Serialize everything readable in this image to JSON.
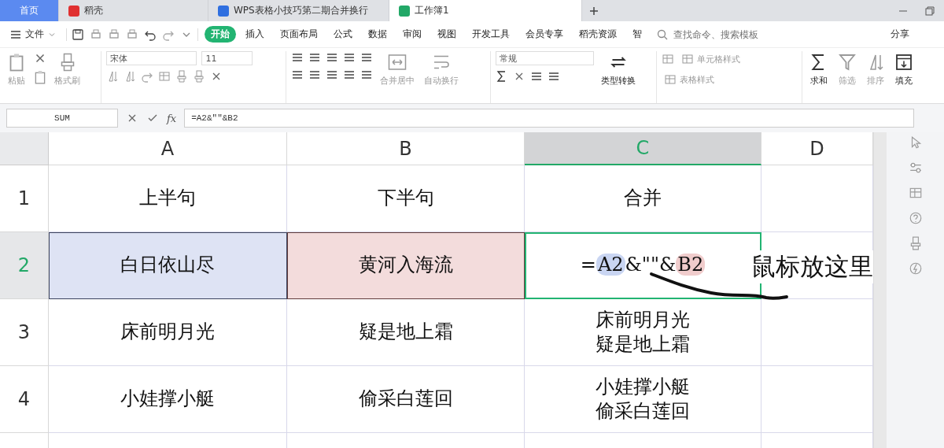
{
  "tabs": [
    {
      "label": "首页",
      "kind": "home",
      "selected": false
    },
    {
      "label": "稻壳",
      "kind": "app",
      "selected": false
    },
    {
      "label": "WPS表格小技巧第二期合并换行",
      "kind": "doc",
      "selected": false
    },
    {
      "label": "工作簿1",
      "kind": "sheet",
      "selected": true
    }
  ],
  "menu": {
    "file": "文件",
    "ribbon_tabs": [
      {
        "label": "开始",
        "selected": true
      },
      {
        "label": "插入",
        "selected": false
      },
      {
        "label": "页面布局",
        "selected": false
      },
      {
        "label": "公式",
        "selected": false
      },
      {
        "label": "数据",
        "selected": false
      },
      {
        "label": "审阅",
        "selected": false
      },
      {
        "label": "视图",
        "selected": false
      },
      {
        "label": "开发工具",
        "selected": false
      },
      {
        "label": "会员专享",
        "selected": false
      },
      {
        "label": "稻壳资源",
        "selected": false
      },
      {
        "label": "智",
        "selected": false
      }
    ],
    "search": {
      "placeholder": "查找命令、搜索模板"
    },
    "share": "分享"
  },
  "ribbon": {
    "font": "宋体",
    "size": "11",
    "number_format": "常规",
    "buttons": [
      {
        "label": "粘贴",
        "disabled": true
      },
      {
        "label": "格式刷",
        "disabled": true
      },
      {
        "label": "合并居中",
        "disabled": true
      },
      {
        "label": "自动换行",
        "disabled": true
      },
      {
        "label": "类型转换",
        "disabled": false
      },
      {
        "label": "单元格样式",
        "disabled": true
      },
      {
        "label": "表格样式",
        "disabled": true
      },
      {
        "label": "求和",
        "disabled": false
      },
      {
        "label": "筛选",
        "disabled": true
      },
      {
        "label": "排序",
        "disabled": true
      },
      {
        "label": "填充",
        "disabled": false
      }
    ]
  },
  "formula_bar": {
    "name_box": "SUM",
    "fx": "fx",
    "formula": "=A2&\"\"&B2"
  },
  "sheet": {
    "columns": [
      {
        "label": "A",
        "selected": false
      },
      {
        "label": "B",
        "selected": false
      },
      {
        "label": "C",
        "selected": true
      },
      {
        "label": "D",
        "selected": false
      }
    ],
    "rows": [
      {
        "label": "1",
        "selected": false,
        "cells": [
          {
            "text": "上半句"
          },
          {
            "text": "下半句"
          },
          {
            "text": "合并"
          },
          {}
        ]
      },
      {
        "label": "2",
        "selected": true,
        "cells": [
          {
            "text": "白日依山尽",
            "color": "#dee3f4"
          },
          {
            "text": "黄河入海流",
            "color": "#f3dcdc"
          },
          {
            "kind": "formula",
            "active": true,
            "parts": [
              {
                "text": "="
              },
              {
                "text": "A2",
                "color": "#c9d5f2"
              },
              {
                "text": "&\"\"&"
              },
              {
                "text": "B2",
                "color": "#f0cccc"
              }
            ]
          },
          {}
        ]
      },
      {
        "label": "3",
        "selected": false,
        "cells": [
          {
            "text": "床前明月光"
          },
          {
            "text": "疑是地上霜"
          },
          {
            "lines": [
              "床前明月光",
              "疑是地上霜"
            ]
          },
          {}
        ]
      },
      {
        "label": "4",
        "selected": false,
        "cells": [
          {
            "text": "小娃撑小艇"
          },
          {
            "text": "偷采白莲回"
          },
          {
            "lines": [
              "小娃撑小艇",
              "偷采白莲回"
            ]
          },
          {}
        ]
      }
    ]
  },
  "annotation": {
    "text": "鼠标放这里"
  }
}
